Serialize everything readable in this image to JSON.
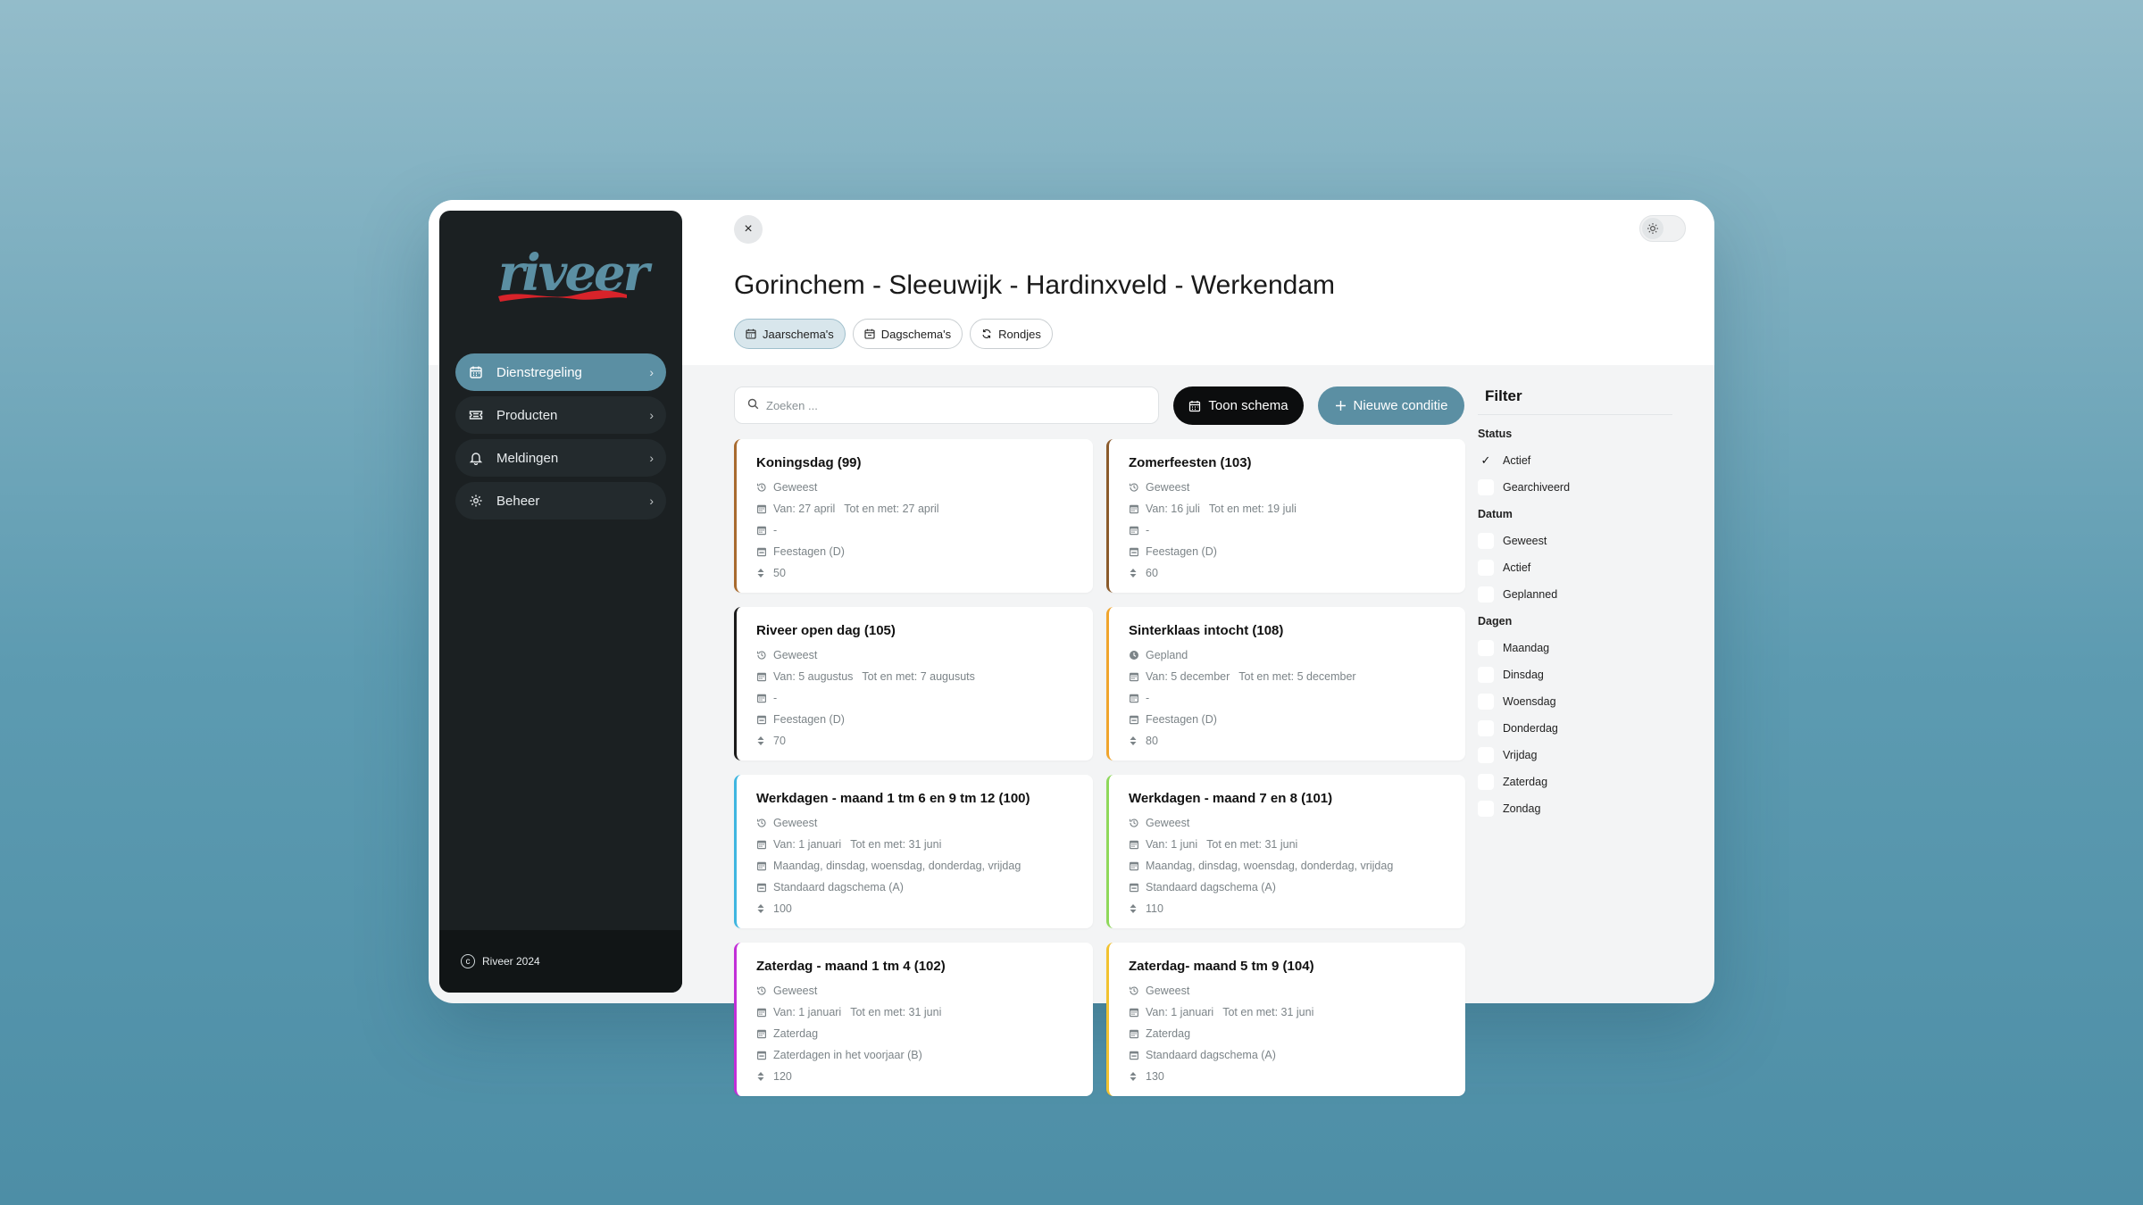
{
  "brand": {
    "logo_text": "riveer",
    "footer": "Riveer 2024"
  },
  "sidebar": {
    "items": [
      {
        "label": "Dienstregeling",
        "icon": "calendar-icon",
        "active": true
      },
      {
        "label": "Producten",
        "icon": "ticket-icon",
        "active": false
      },
      {
        "label": "Meldingen",
        "icon": "bell-icon",
        "active": false
      },
      {
        "label": "Beheer",
        "icon": "gear-icon",
        "active": false
      }
    ]
  },
  "header": {
    "close_label": "×",
    "title": "Gorinchem - Sleeuwijk - Hardinxveld - Werkendam",
    "tabs": [
      {
        "label": "Jaarschema's",
        "active": true
      },
      {
        "label": "Dagschema's",
        "active": false
      },
      {
        "label": "Rondjes",
        "active": false
      }
    ]
  },
  "toolbar": {
    "search_placeholder": "Zoeken ...",
    "show_schedule_label": "Toon schema",
    "new_condition_label": "Nieuwe conditie"
  },
  "cards": [
    {
      "title": "Koningsdag (99)",
      "status": "Geweest",
      "status_icon": "history-icon",
      "from": "Van: 27 april",
      "to": "Tot en met: 27 april",
      "days": "-",
      "schedule": "Feestagen (D)",
      "priority": "50",
      "accent": "#a86a2e"
    },
    {
      "title": "Zomerfeesten (103)",
      "status": "Geweest",
      "status_icon": "history-icon",
      "from": "Van: 16 juli",
      "to": "Tot en met: 19 juli",
      "days": "-",
      "schedule": "Feestagen (D)",
      "priority": "60",
      "accent": "#8a5a2b"
    },
    {
      "title": "Riveer open dag (105)",
      "status": "Geweest",
      "status_icon": "history-icon",
      "from": "Van: 5 augustus",
      "to": "Tot en met: 7 augusuts",
      "days": "-",
      "schedule": "Feestagen (D)",
      "priority": "70",
      "accent": "#1a1a1a"
    },
    {
      "title": "Sinterklaas intocht (108)",
      "status": "Gepland",
      "status_icon": "clock-icon",
      "from": "Van: 5 december",
      "to": "Tot en met: 5 december",
      "days": "-",
      "schedule": "Feestagen (D)",
      "priority": "80",
      "accent": "#f0a42c"
    },
    {
      "title": "Werkdagen - maand 1 tm 6 en 9 tm 12 (100)",
      "status": "Geweest",
      "status_icon": "history-icon",
      "from": "Van: 1 januari",
      "to": "Tot en met: 31 juni",
      "days": "Maandag, dinsdag, woensdag, donderdag, vrijdag",
      "schedule": "Standaard dagschema (A)",
      "priority": "100",
      "accent": "#3fb6e0"
    },
    {
      "title": "Werkdagen - maand 7 en 8 (101)",
      "status": "Geweest",
      "status_icon": "history-icon",
      "from": "Van: 1 juni",
      "to": "Tot en met: 31 juni",
      "days": "Maandag, dinsdag, woensdag, donderdag, vrijdag",
      "schedule": "Standaard dagschema (A)",
      "priority": "110",
      "accent": "#8ed85a"
    },
    {
      "title": "Zaterdag - maand 1 tm 4 (102)",
      "status": "Geweest",
      "status_icon": "history-icon",
      "from": "Van: 1 januari",
      "to": "Tot en met: 31 juni",
      "days": "Zaterdag",
      "schedule": "Zaterdagen in het voorjaar (B)",
      "priority": "120",
      "accent": "#c22fd8"
    },
    {
      "title": "Zaterdag- maand 5 tm 9 (104)",
      "status": "Geweest",
      "status_icon": "history-icon",
      "from": "Van: 1 januari",
      "to": "Tot en met: 31 juni",
      "days": "Zaterdag",
      "schedule": "Standaard dagschema (A)",
      "priority": "130",
      "accent": "#f2c230"
    }
  ],
  "filter": {
    "title": "Filter",
    "sections": [
      {
        "label": "Status",
        "options": [
          {
            "label": "Actief",
            "checked": true
          },
          {
            "label": "Gearchiveerd",
            "checked": false
          }
        ]
      },
      {
        "label": "Datum",
        "options": [
          {
            "label": "Geweest",
            "checked": false
          },
          {
            "label": "Actief",
            "checked": false
          },
          {
            "label": "Geplanned",
            "checked": false
          }
        ]
      },
      {
        "label": "Dagen",
        "options": [
          {
            "label": "Maandag",
            "checked": false
          },
          {
            "label": "Dinsdag",
            "checked": false
          },
          {
            "label": "Woensdag",
            "checked": false
          },
          {
            "label": "Donderdag",
            "checked": false
          },
          {
            "label": "Vrijdag",
            "checked": false
          },
          {
            "label": "Zaterdag",
            "checked": false
          },
          {
            "label": "Zondag",
            "checked": false
          }
        ]
      }
    ]
  },
  "colors": {
    "accent": "#5b8fa3",
    "sidebar_bg": "#1b2022",
    "dark_button": "#0c0d0e"
  }
}
